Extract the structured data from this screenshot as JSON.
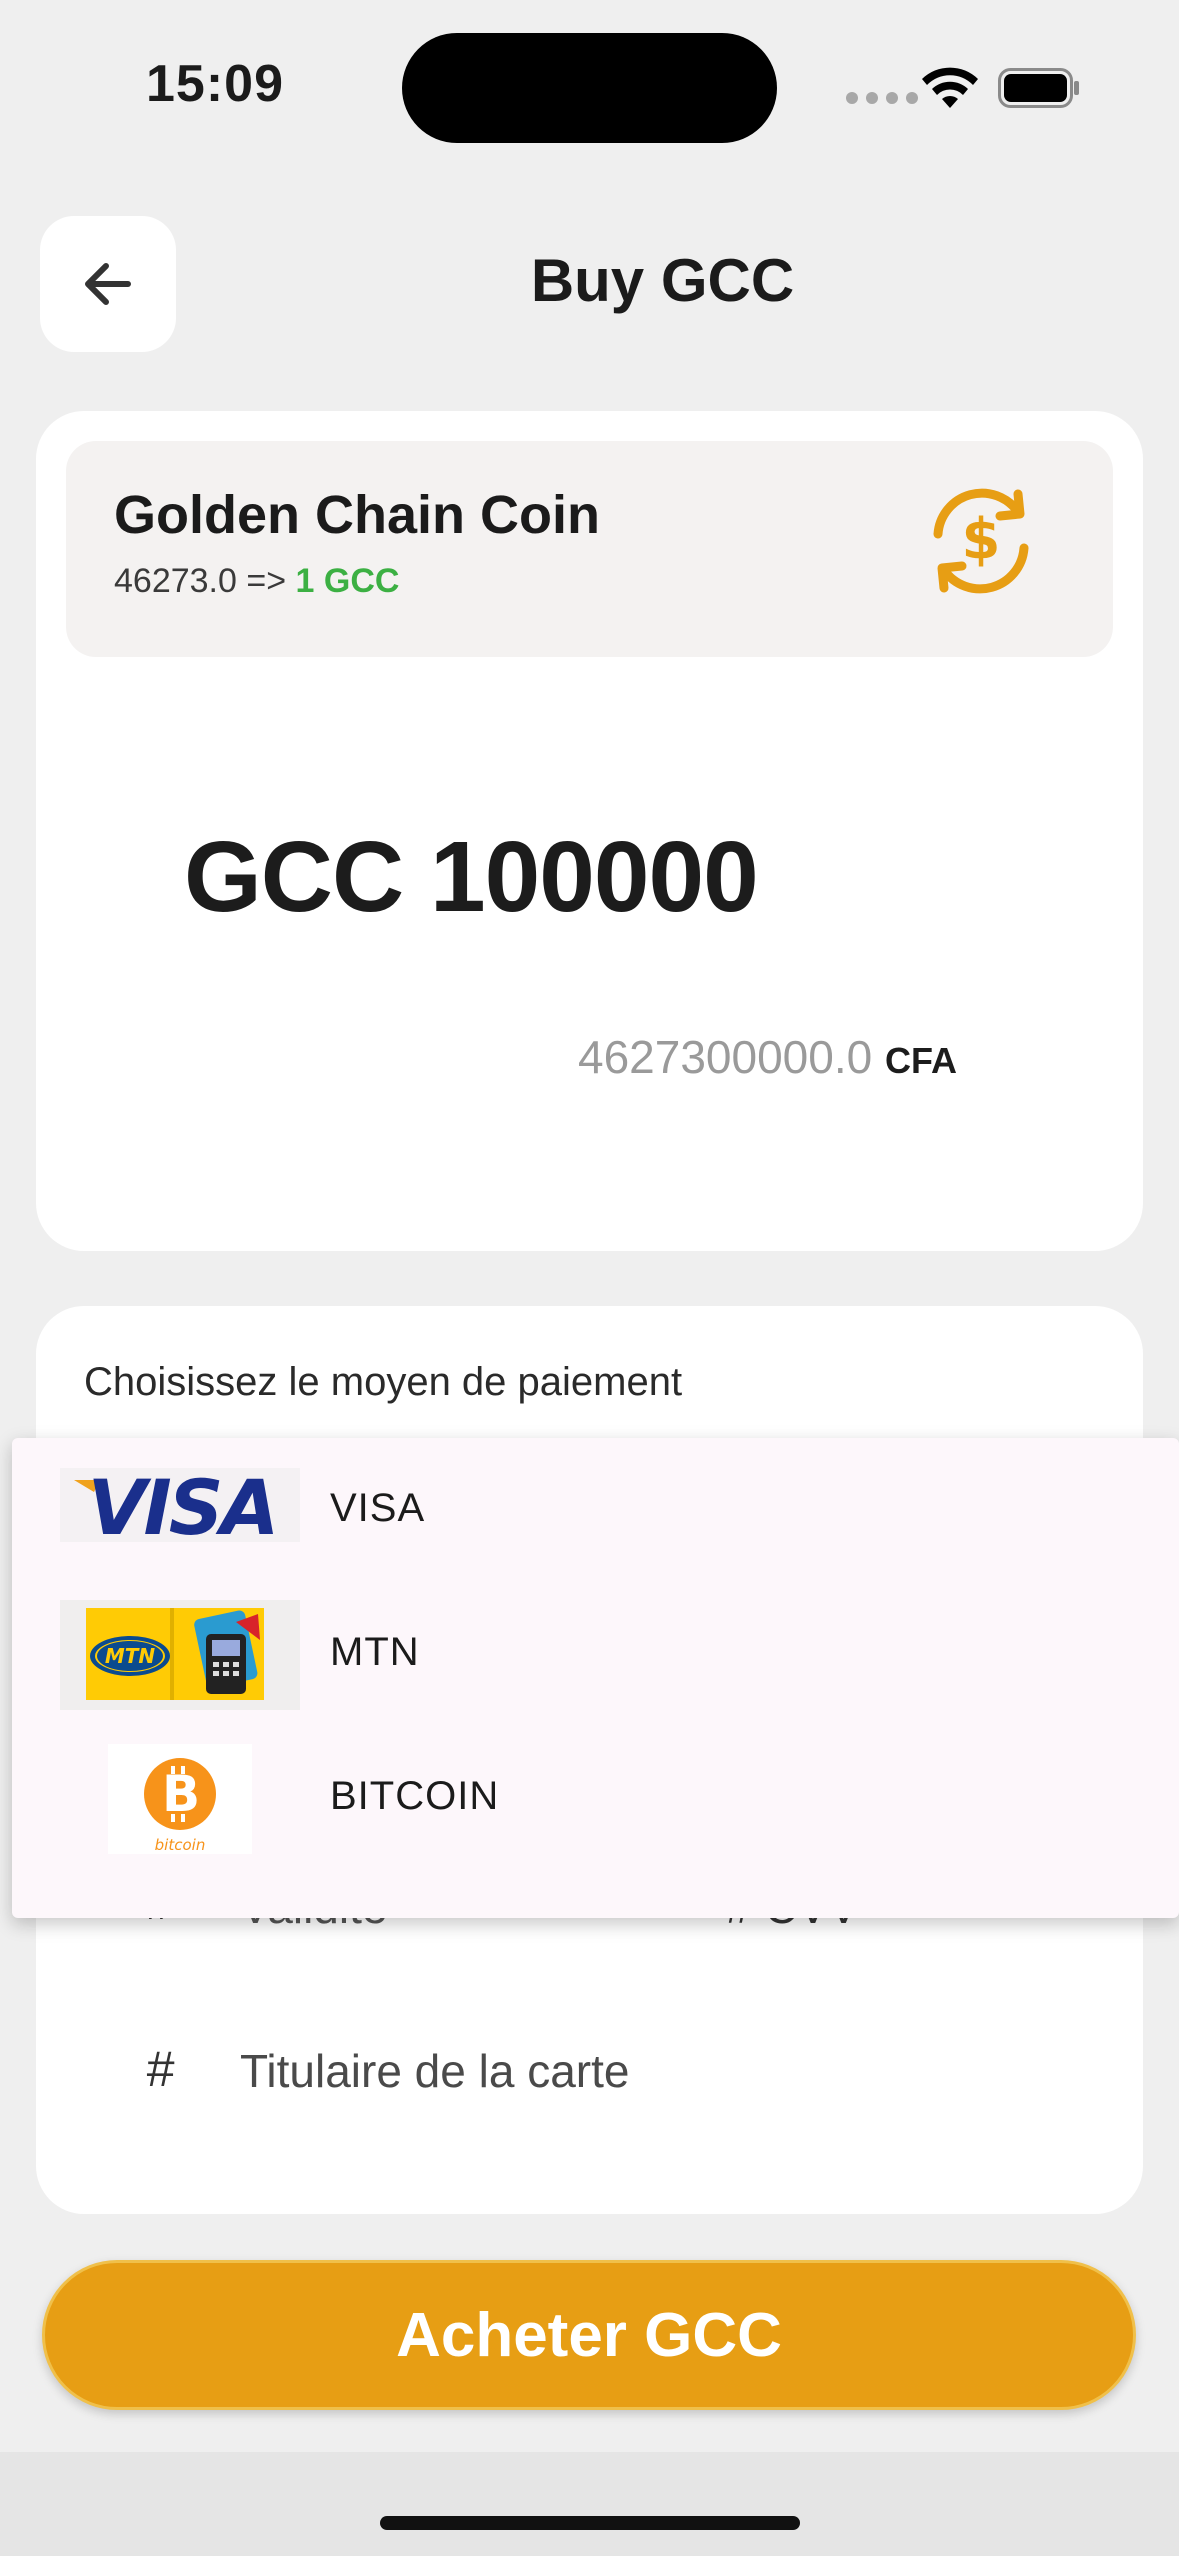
{
  "status_bar": {
    "time": "15:09"
  },
  "header": {
    "title": "Buy GCC"
  },
  "coin": {
    "name": "Golden Chain Coin",
    "rate_prefix": "46273.0 =>",
    "rate_unit": "1 GCC"
  },
  "amount": {
    "display": "GCC 100000"
  },
  "conversion": {
    "value": "4627300000.0",
    "currency": "CFA"
  },
  "payment": {
    "label": "Choisissez le moyen de paiement",
    "options": [
      {
        "label": "VISA",
        "icon": "visa-logo"
      },
      {
        "label": "MTN",
        "icon": "mtn-logo"
      },
      {
        "label": "BITCOIN",
        "icon": "bitcoin-logo",
        "logo_caption": "bitcoin"
      }
    ]
  },
  "form": {
    "hash": "#",
    "validity_partial": "Validite",
    "cvv_partial": "# CVV",
    "holder": "Titulaire de la carte"
  },
  "buy_button": {
    "label": "Acheter GCC"
  },
  "colors": {
    "accent": "#e79e14",
    "rate_green": "#3cb043",
    "background": "#efefef"
  }
}
